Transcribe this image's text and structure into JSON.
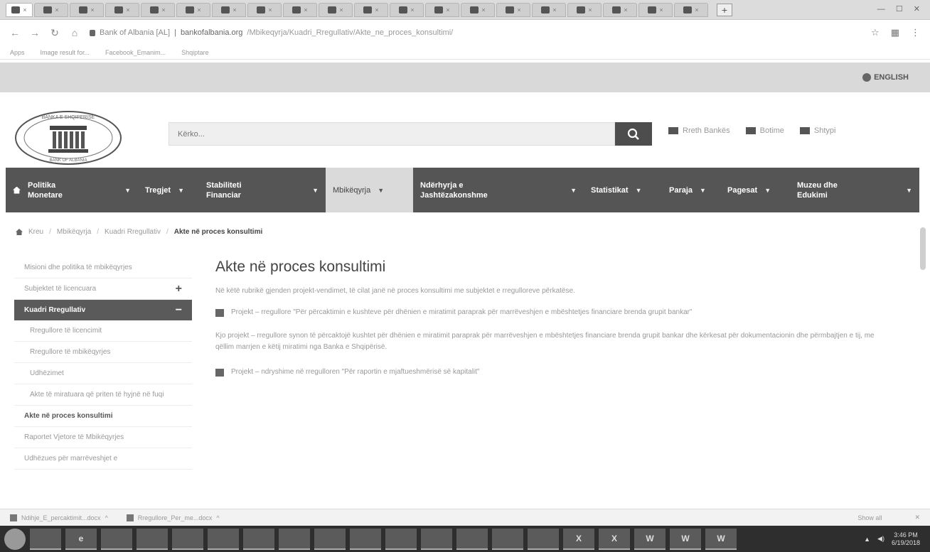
{
  "browser": {
    "tab_count": 20,
    "url_site": "Bank of Albania [AL]",
    "url_domain": "bankofalbania.org",
    "url_path": "/Mbikeqyrja/Kuadri_Rregullativ/Akte_ne_proces_konsultimi/",
    "bookmarks": [
      "Apps",
      "Image result for...",
      "Facebook_Emanim...",
      "Shqiptare"
    ]
  },
  "header": {
    "lang_label": "ENGLISH",
    "logo_text_top": "BANKA E SHQIPERISE",
    "logo_text_bottom": "BANK OF ALBANIA",
    "search_placeholder": "Kërko...",
    "quick_links": [
      "Rreth Bankës",
      "Botime",
      "Shtypi"
    ]
  },
  "nav": {
    "items": [
      {
        "label_1": "Politika",
        "label_2": "Monetare",
        "has_home": true
      },
      {
        "label_1": "Tregjet",
        "label_2": ""
      },
      {
        "label_1": "Stabiliteti",
        "label_2": "Financiar"
      },
      {
        "label_1": "Mbikëqyrja",
        "label_2": "",
        "active": true
      },
      {
        "label_1": "Ndërhyrja e",
        "label_2": "Jashtëzakonshme"
      },
      {
        "label_1": "Statistikat",
        "label_2": ""
      },
      {
        "label_1": "Paraja",
        "label_2": ""
      },
      {
        "label_1": "Pagesat",
        "label_2": ""
      },
      {
        "label_1": "Muzeu dhe",
        "label_2": "Edukimi"
      }
    ]
  },
  "breadcrumb": {
    "items": [
      "Kreu",
      "Mbikëqyrja",
      "Kuadri Rregullativ"
    ],
    "current": "Akte në proces konsultimi"
  },
  "sidebar": {
    "items": [
      {
        "label": "Misioni dhe politika të mbikëqyrjes",
        "type": "normal",
        "mark": ""
      },
      {
        "label": "Subjektet të licencuara",
        "type": "normal",
        "mark": "+"
      },
      {
        "label": "Kuadri Rregullativ",
        "type": "active",
        "mark": "−"
      },
      {
        "label": "Rregullore të licencimit",
        "type": "sub",
        "mark": ""
      },
      {
        "label": "Rregullore të mbikëqyrjes",
        "type": "sub",
        "mark": ""
      },
      {
        "label": "Udhëzimet",
        "type": "sub",
        "mark": ""
      },
      {
        "label": "Akte të miratuara që priten të hyjnë në fuqi",
        "type": "sub",
        "mark": ""
      },
      {
        "label": "Akte në proces konsultimi",
        "type": "cur",
        "mark": ""
      },
      {
        "label": "Raportet Vjetore të Mbikëqyrjes",
        "type": "normal",
        "mark": ""
      },
      {
        "label": "Udhëzues për marrëveshjet e",
        "type": "normal",
        "mark": ""
      }
    ]
  },
  "content": {
    "title": "Akte në proces konsultimi",
    "intro": "Në këtë rubrikë gjenden projekt-vendimet, të cilat janë në proces konsultimi me subjektet e rregulloreve përkatëse.",
    "doc1": "Projekt – rregullore \"Për përcaktimin e kushteve për dhënien e miratimit paraprak për marrëveshjen e mbështetjes financiare brenda grupit bankar\"",
    "desc": "Kjo projekt – rregullore synon të përcaktojë kushtet për dhënien e miratimit paraprak për marrëveshjen e mbështetjes financiare brenda grupit bankar dhe kërkesat për dokumentacionin dhe përmbajtjen e tij, me qëllim marrjen e këtij miratimi nga Banka e Shqipërisë.",
    "doc2": "Projekt – ndryshime në rregulloren \"Për raportin e mjaftueshmërisë së kapitalit\""
  },
  "downloads": {
    "files": [
      "Ndihje_E_percaktimit...docx",
      "Rregullore_Per_me...docx"
    ],
    "show_all": "Show all"
  },
  "taskbar": {
    "apps": [
      "",
      "e",
      "",
      "",
      "",
      "",
      "",
      "",
      "",
      "",
      "",
      "",
      "",
      "",
      "",
      "X",
      "X",
      "W",
      "W",
      "W"
    ],
    "time": "3:46 PM",
    "date": "6/19/2018"
  }
}
